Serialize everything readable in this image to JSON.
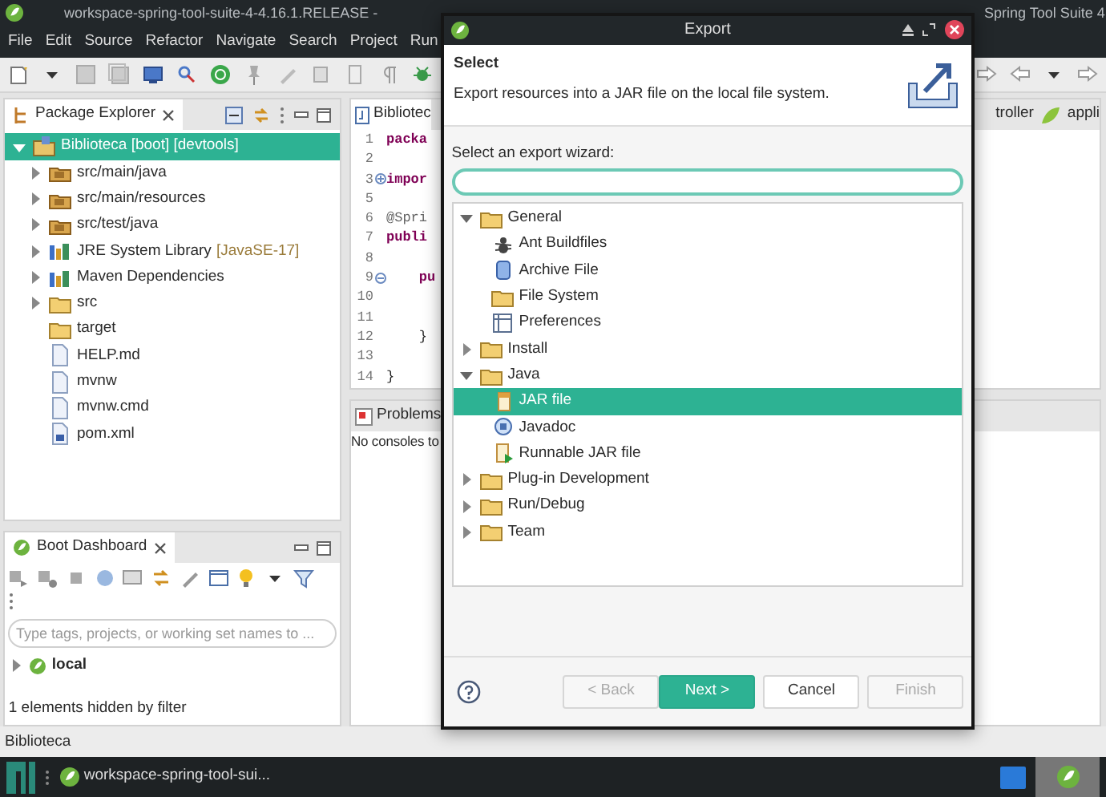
{
  "window": {
    "title_parts": [
      "workspace-spring-tool-suite-4-4.16.1.RELEASE -",
      "Spring Tool Suite 4"
    ]
  },
  "menu": [
    "File",
    "Edit",
    "Source",
    "Refactor",
    "Navigate",
    "Search",
    "Project",
    "Run"
  ],
  "package_explorer": {
    "title": "Package Explorer",
    "tree": [
      {
        "label": "Biblioteca [boot] [devtools]",
        "kind": "project",
        "selected": true,
        "expanded": true,
        "children": [
          {
            "label": "src/main/java",
            "kind": "package-root",
            "selected": false,
            "expanded": false
          },
          {
            "label": "src/main/resources",
            "kind": "package-root",
            "selected": false,
            "expanded": false
          },
          {
            "label": "src/test/java",
            "kind": "package-root",
            "selected": false,
            "expanded": false
          },
          {
            "label": "JRE System Library",
            "decoration": "[JavaSE-17]",
            "kind": "library",
            "selected": false,
            "expanded": false
          },
          {
            "label": "Maven Dependencies",
            "kind": "library",
            "selected": false,
            "expanded": false
          },
          {
            "label": "src",
            "kind": "folder",
            "selected": false,
            "expanded": false
          },
          {
            "label": "target",
            "kind": "folder",
            "selected": false
          },
          {
            "label": "HELP.md",
            "kind": "file",
            "selected": false
          },
          {
            "label": "mvnw",
            "kind": "file",
            "selected": false
          },
          {
            "label": "mvnw.cmd",
            "kind": "file",
            "selected": false
          },
          {
            "label": "pom.xml",
            "kind": "xml",
            "selected": false
          }
        ]
      }
    ]
  },
  "editor": {
    "tabs": [
      {
        "label": "Bibliotec",
        "selected": true
      },
      {
        "label": "troller",
        "selected": false
      },
      {
        "label": "appli",
        "selected": false
      }
    ],
    "lines": [
      {
        "number": "1",
        "code": "packa",
        "kind": "keyword"
      },
      {
        "number": "2"
      },
      {
        "number": "3",
        "code": "impor",
        "kind": "keyword",
        "collapsed": true
      },
      {
        "number": "5"
      },
      {
        "number": "6",
        "code": "@Spri",
        "kind": "annotation"
      },
      {
        "number": "7",
        "code": "publi",
        "kind": "keyword"
      },
      {
        "number": "8"
      },
      {
        "number": "9",
        "code": "    pu",
        "kind": "keyword",
        "collapsed": false
      },
      {
        "number": "10"
      },
      {
        "number": "11"
      },
      {
        "number": "12",
        "code": "    }",
        "kind": "plain"
      },
      {
        "number": "13"
      },
      {
        "number": "14",
        "code": "}",
        "kind": "plain"
      }
    ]
  },
  "console": {
    "tab": "Problems",
    "message": "No consoles to"
  },
  "boot_dashboard": {
    "title": "Boot Dashboard",
    "search": {
      "placeholder": "Type tags, projects, or working set names to ..."
    },
    "tree": [
      {
        "label": "local",
        "expanded": false
      }
    ],
    "footer": "1 elements hidden by filter"
  },
  "status_bar": {
    "text": "Biblioteca"
  },
  "taskbar": {
    "window_label": "workspace-spring-tool-sui..."
  },
  "dialog": {
    "title": "Export",
    "heading": "Select",
    "description": "Export resources into a JAR file on the local file system.",
    "filter_label": "Select an export wizard:",
    "tree": [
      {
        "label": "General",
        "selected": false,
        "expanded": true,
        "children": [
          {
            "label": "Ant Buildfiles",
            "kind": "ant",
            "selected": false
          },
          {
            "label": "Archive File",
            "kind": "archive",
            "selected": false
          },
          {
            "label": "File System",
            "kind": "folder",
            "selected": false
          },
          {
            "label": "Preferences",
            "kind": "preferences",
            "selected": false
          }
        ]
      },
      {
        "label": "Install",
        "selected": false,
        "expanded": false
      },
      {
        "label": "Java",
        "selected": false,
        "expanded": true,
        "children": [
          {
            "label": "JAR file",
            "kind": "jar",
            "selected": true
          },
          {
            "label": "Javadoc",
            "kind": "javadoc",
            "selected": false
          },
          {
            "label": "Runnable JAR file",
            "kind": "runnable-jar",
            "selected": false
          }
        ]
      },
      {
        "label": "Plug-in Development",
        "selected": false,
        "expanded": false
      },
      {
        "label": "Run/Debug",
        "selected": false,
        "expanded": false
      },
      {
        "label": "Team",
        "selected": false,
        "expanded": false
      }
    ],
    "buttons": [
      {
        "label": "< Back",
        "disabled": true,
        "primary": false
      },
      {
        "label": "Next >",
        "disabled": false,
        "primary": true
      },
      {
        "label": "Cancel",
        "disabled": false,
        "primary": false
      },
      {
        "label": "Finish",
        "disabled": true,
        "primary": false
      }
    ]
  }
}
